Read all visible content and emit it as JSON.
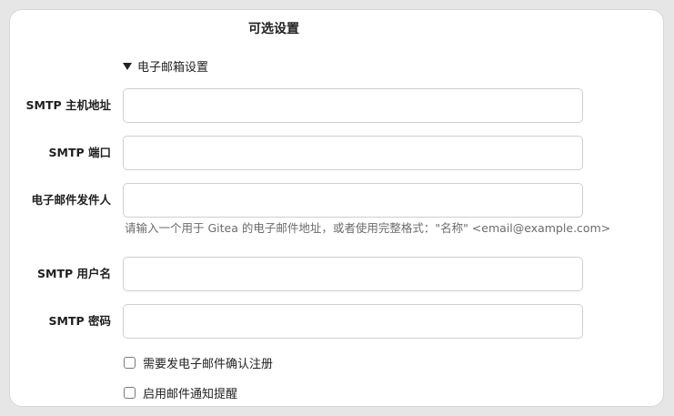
{
  "section": {
    "title": "可选设置"
  },
  "email_settings": {
    "summary_label": "电子邮箱设置",
    "fields": {
      "smtp_host": {
        "label": "SMTP 主机地址",
        "value": "",
        "placeholder": ""
      },
      "smtp_port": {
        "label": "SMTP 端口",
        "value": "",
        "placeholder": ""
      },
      "mail_from": {
        "label": "电子邮件发件人",
        "value": "",
        "placeholder": ""
      },
      "smtp_user": {
        "label": "SMTP 用户名",
        "value": "",
        "placeholder": ""
      },
      "smtp_password": {
        "label": "SMTP 密码",
        "value": "",
        "placeholder": ""
      }
    },
    "mail_from_help": "请输入一个用于 Gitea 的电子邮件地址，或者使用完整格式：\"名称\" <email@example.com>",
    "checkboxes": {
      "register_confirm": {
        "label": "需要发电子邮件确认注册",
        "checked": false
      },
      "mail_notify": {
        "label": "启用邮件通知提醒",
        "checked": false
      }
    }
  }
}
